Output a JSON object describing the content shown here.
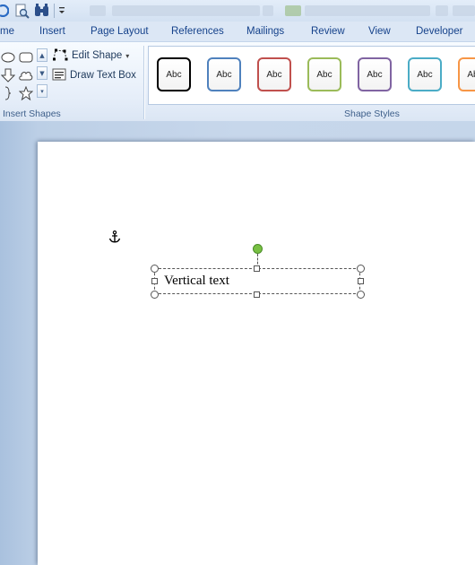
{
  "quick_access": {
    "icons": [
      "undo-icon",
      "print-preview-icon",
      "find-icon",
      "customize-dropdown-icon"
    ]
  },
  "tabs": [
    {
      "id": "home",
      "label": "me"
    },
    {
      "id": "insert",
      "label": "Insert"
    },
    {
      "id": "page-layout",
      "label": "Page Layout"
    },
    {
      "id": "references",
      "label": "References"
    },
    {
      "id": "mailings",
      "label": "Mailings"
    },
    {
      "id": "review",
      "label": "Review"
    },
    {
      "id": "view",
      "label": "View"
    },
    {
      "id": "developer",
      "label": "Developer"
    }
  ],
  "ribbon": {
    "insert_shapes": {
      "label": "Insert Shapes",
      "edit_shape": "Edit Shape",
      "draw_text_box": "Draw Text Box"
    },
    "shape_styles": {
      "label": "Shape Styles",
      "swatch_text": "Abc",
      "swatches": [
        {
          "border": "#000000"
        },
        {
          "border": "#4f81bd"
        },
        {
          "border": "#c0504d"
        },
        {
          "border": "#9bbb59"
        },
        {
          "border": "#8064a2"
        },
        {
          "border": "#4bacc6"
        },
        {
          "border": "#f79646"
        }
      ]
    }
  },
  "document": {
    "textbox_text": "Vertical text"
  },
  "colors": {
    "rotation_handle": "#78c043",
    "page": "#ffffff"
  }
}
